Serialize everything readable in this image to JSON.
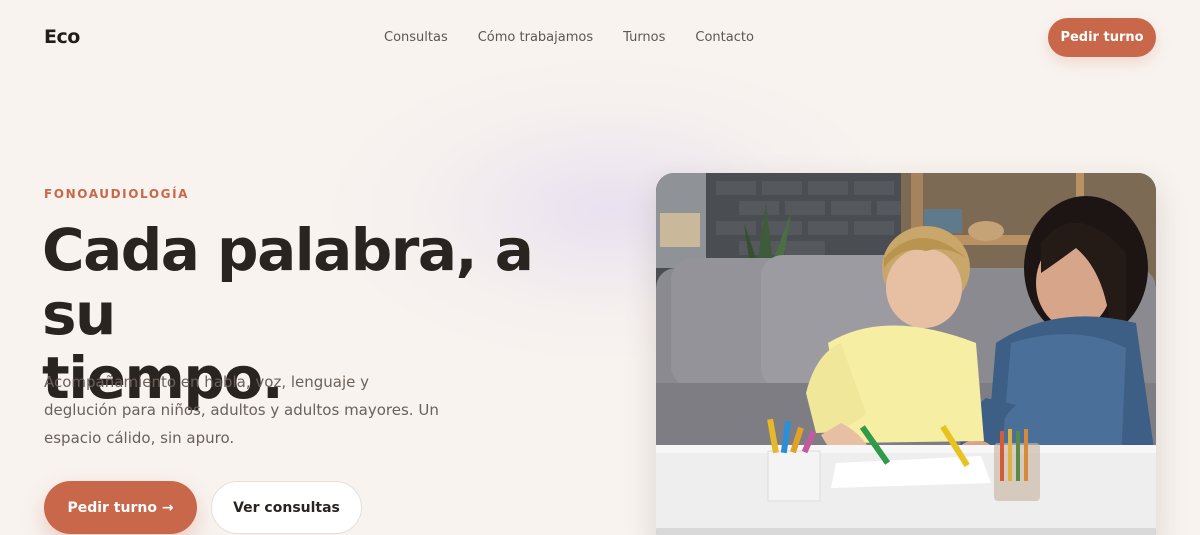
{
  "brand": {
    "name": "Eco"
  },
  "nav": {
    "items": [
      {
        "label": "Consultas"
      },
      {
        "label": "Cómo trabajamos"
      },
      {
        "label": "Turnos"
      },
      {
        "label": "Contacto"
      }
    ],
    "cta_label": "Pedir turno"
  },
  "hero": {
    "eyebrow": "FONOAUDIOLOGÍA",
    "title_line1": "Cada palabra, a su",
    "title_line2": "tiempo.",
    "subtitle": "Acompañamiento en habla, voz, lenguaje y deglución para niños, adultos y adultos mayores. Un espacio cálido, sin apuro.",
    "primary_cta": "Pedir turno →",
    "secondary_cta": "Ver consultas",
    "image_subject": "child-drawing-with-woman-photo"
  },
  "colors": {
    "accent": "#c8674a",
    "background": "#f8f3ef",
    "text": "#2a2420",
    "muted": "#6b615b"
  }
}
